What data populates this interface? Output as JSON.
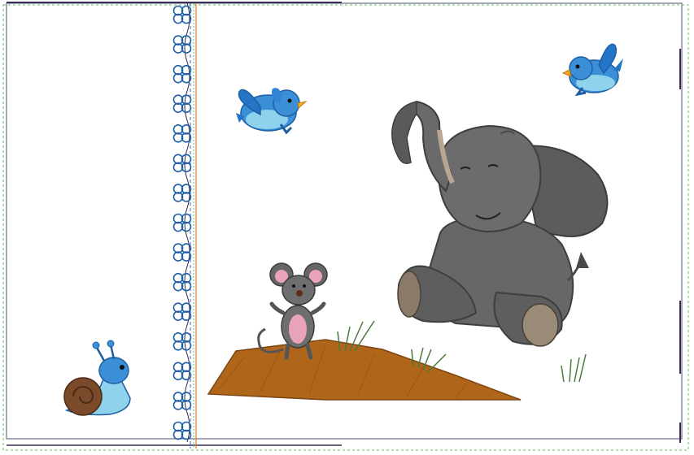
{
  "canvas": {
    "background": "#ffffff",
    "colors": {
      "outer_border": "#6a6f8a",
      "green_dash": "#5cbf5c",
      "blue_dash": "#3b5bdb",
      "orange_line": "#e07a3a",
      "dark_stroke": "#3a2a55",
      "flower": "#1f5fa8"
    },
    "decorations": {
      "flower_border": {
        "icon": "four-petal-flower-icon",
        "count": 15
      }
    }
  },
  "elements": [
    {
      "name": "bluebird-left",
      "icon": "bluebird-icon"
    },
    {
      "name": "bluebird-right",
      "icon": "bluebird-icon"
    },
    {
      "name": "elephant",
      "icon": "elephant-icon"
    },
    {
      "name": "mouse",
      "icon": "mouse-icon"
    },
    {
      "name": "snail",
      "icon": "snail-icon"
    },
    {
      "name": "dirt-mound",
      "icon": "dirt-mound-shape"
    },
    {
      "name": "grass-tufts",
      "icon": "grass-icon"
    }
  ]
}
